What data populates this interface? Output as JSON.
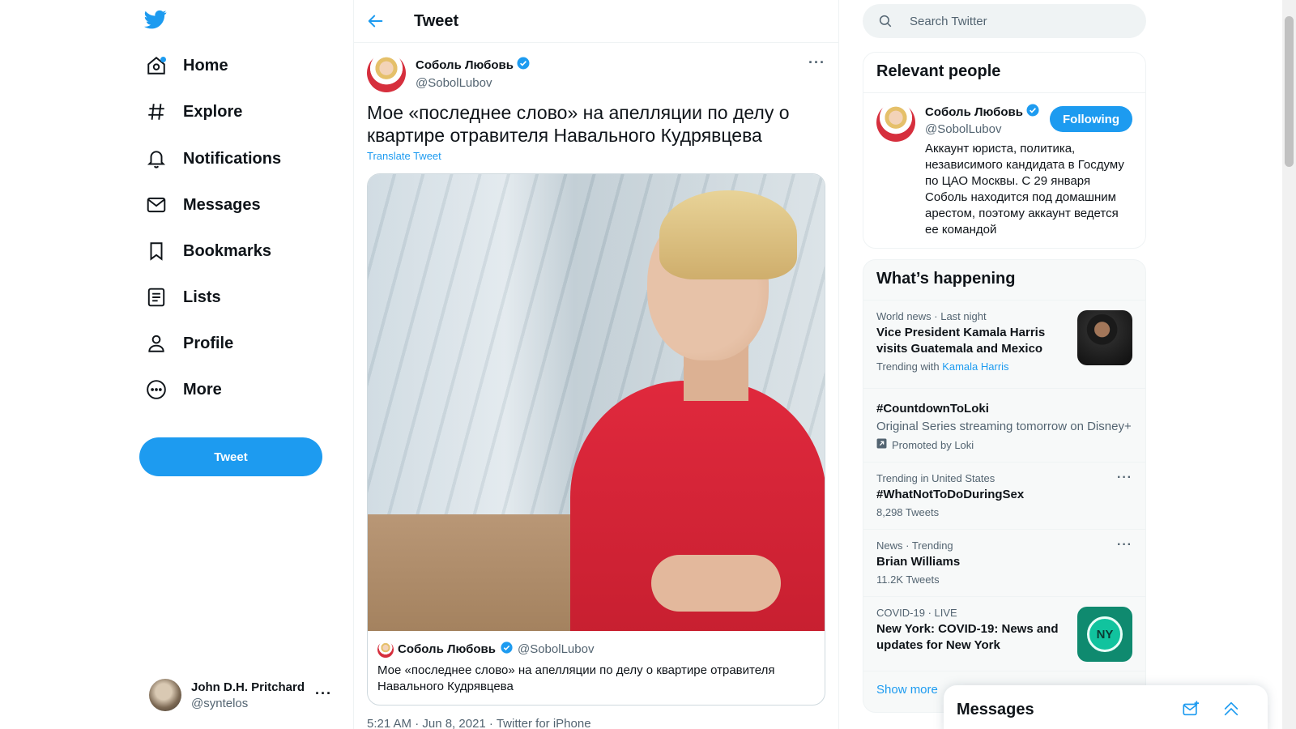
{
  "nav": {
    "items": [
      {
        "label": "Home",
        "icon": "home-icon"
      },
      {
        "label": "Explore",
        "icon": "hashtag-icon"
      },
      {
        "label": "Notifications",
        "icon": "bell-icon"
      },
      {
        "label": "Messages",
        "icon": "envelope-icon"
      },
      {
        "label": "Bookmarks",
        "icon": "bookmark-icon"
      },
      {
        "label": "Lists",
        "icon": "list-icon"
      },
      {
        "label": "Profile",
        "icon": "person-icon"
      },
      {
        "label": "More",
        "icon": "more-circle-icon"
      }
    ],
    "tweet_button": "Tweet"
  },
  "account": {
    "name": "John D.H. Pritchard",
    "handle": "@syntelos",
    "more": "···"
  },
  "header": {
    "title": "Tweet"
  },
  "tweet": {
    "author_name": "Соболь Любовь",
    "author_handle": "@SobolLubov",
    "more": "···",
    "text": "Мое «последнее слово» на апелляции по делу о квартире отравителя Навального Кудрявцева",
    "translate_label": "Translate Tweet",
    "media_caption": {
      "name": "Соболь Любовь",
      "handle": "@SobolLubov",
      "text": "Мое «последнее слово» на апелляции по делу о квартире отравителя Навального Кудрявцева"
    },
    "meta": "5:21 AM · Jun 8, 2021 · Twitter for iPhone"
  },
  "search": {
    "placeholder": "Search Twitter"
  },
  "relevant_people": {
    "title": "Relevant people",
    "person": {
      "name": "Соболь Любовь",
      "handle": "@SobolLubov",
      "follow_label": "Following",
      "bio": "Аккаунт юриста, политика, независимого кандидата в Госдуму по ЦАО Москвы. С 29 января Соболь находится под домашним арестом, поэтому аккаунт ведется ее командой"
    }
  },
  "whats_happening": {
    "title": "What’s happening",
    "trends": [
      {
        "meta": "World news · Last night",
        "title": "Vice President Kamala Harris visits Guatemala and Mexico",
        "sub_prefix": "Trending with",
        "sub_link": "Kamala Harris"
      },
      {
        "title": "#CountdownToLoki",
        "sub": "Original Series streaming tomorrow on Disney+",
        "promo": "Promoted by Loki"
      },
      {
        "meta": "Trending in United States",
        "title": "#WhatNotToDoDuringSex",
        "sub": "8,298 Tweets",
        "more": "···"
      },
      {
        "meta": "News · Trending",
        "title": "Brian Williams",
        "sub": "11.2K Tweets",
        "more": "···"
      },
      {
        "meta": "COVID-19 · LIVE",
        "title": "New York: COVID-19: News and updates for New York",
        "badge": "NY"
      }
    ],
    "show_more": "Show more"
  },
  "messages_drawer": {
    "title": "Messages"
  },
  "colors": {
    "accent": "#1d9bf0",
    "text": "#0f1419",
    "muted": "#536471",
    "border": "#eff3f4"
  }
}
